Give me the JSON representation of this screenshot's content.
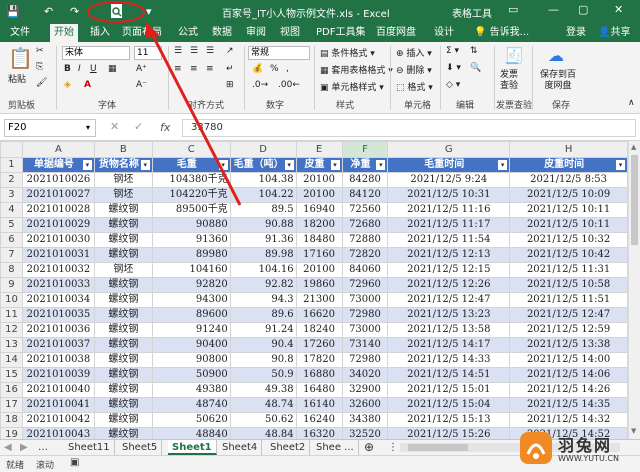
{
  "titlebar": {
    "title": "百家号_IT小人物示例文件.xls - Excel",
    "tools": "表格工具",
    "undo": "↶",
    "redo": "↷"
  },
  "tabs": [
    "文件",
    "开始",
    "插入",
    "页面布局",
    "公式",
    "数据",
    "审阅",
    "视图",
    "PDF工具集",
    "百度网盘",
    "设计"
  ],
  "tabs_extra": {
    "tell": "告诉我...",
    "login": "登录",
    "share": "共享"
  },
  "ribbon": {
    "paste": "粘贴",
    "clipboard": "剪贴板",
    "font_name": "宋体",
    "font_size": "11",
    "font": "字体",
    "align": "对齐方式",
    "num_format": "常规",
    "number": "数字",
    "percent": "%",
    "comma": ",",
    "cond": "条件格式",
    "table_fmt": "套用表格格式",
    "cell_style": "单元格样式",
    "styles": "样式",
    "insert": "插入",
    "delete": "删除",
    "format": "格式",
    "cells": "单元格",
    "edit": "编辑",
    "invoice": "发票查验",
    "invoice_grp": "发票查验",
    "save_baidu": "保存到百度网盘",
    "save_grp": "保存"
  },
  "formula": {
    "namebox": "F20",
    "fx": "fx",
    "value": "33780"
  },
  "columns": [
    "A",
    "B",
    "C",
    "D",
    "E",
    "F",
    "G",
    "H"
  ],
  "headers": [
    "单据编号",
    "货物名称",
    "毛重",
    "毛重（吨）",
    "皮重",
    "净重",
    "毛重时间",
    "皮重时间"
  ],
  "rows": [
    [
      "2021010026",
      "钢坯",
      "104380千克",
      "104.38",
      "20100",
      "84280",
      "2021/12/5 9:24",
      "2021/12/5 8:53"
    ],
    [
      "2021010027",
      "钢坯",
      "104220千克",
      "104.22",
      "20100",
      "84120",
      "2021/12/5 10:31",
      "2021/12/5 10:09"
    ],
    [
      "2021010028",
      "螺纹钢",
      "89500千克",
      "89.5",
      "16940",
      "72560",
      "2021/12/5 11:16",
      "2021/12/5 10:11"
    ],
    [
      "2021010029",
      "螺纹钢",
      "90880",
      "90.88",
      "18200",
      "72680",
      "2021/12/5 11:17",
      "2021/12/5 10:11"
    ],
    [
      "2021010030",
      "螺纹钢",
      "91360",
      "91.36",
      "18480",
      "72880",
      "2021/12/5 11:54",
      "2021/12/5 10:32"
    ],
    [
      "2021010031",
      "螺纹钢",
      "89980",
      "89.98",
      "17160",
      "72820",
      "2021/12/5 12:13",
      "2021/12/5 10:42"
    ],
    [
      "2021010032",
      "钢坯",
      "104160",
      "104.16",
      "20100",
      "84060",
      "2021/12/5 12:15",
      "2021/12/5 11:31"
    ],
    [
      "2021010033",
      "螺纹钢",
      "92820",
      "92.82",
      "19860",
      "72960",
      "2021/12/5 12:26",
      "2021/12/5 10:58"
    ],
    [
      "2021010034",
      "螺纹钢",
      "94300",
      "94.3",
      "21300",
      "73000",
      "2021/12/5 12:47",
      "2021/12/5 11:51"
    ],
    [
      "2021010035",
      "螺纹钢",
      "89600",
      "89.6",
      "16620",
      "72980",
      "2021/12/5 13:23",
      "2021/12/5 12:47"
    ],
    [
      "2021010036",
      "螺纹钢",
      "91240",
      "91.24",
      "18240",
      "73000",
      "2021/12/5 13:58",
      "2021/12/5 12:59"
    ],
    [
      "2021010037",
      "螺纹钢",
      "90400",
      "90.4",
      "17260",
      "73140",
      "2021/12/5 14:17",
      "2021/12/5 13:38"
    ],
    [
      "2021010038",
      "螺纹钢",
      "90800",
      "90.8",
      "17820",
      "72980",
      "2021/12/5 14:33",
      "2021/12/5 14:00"
    ],
    [
      "2021010039",
      "螺纹钢",
      "50900",
      "50.9",
      "16880",
      "34020",
      "2021/12/5 14:51",
      "2021/12/5 14:06"
    ],
    [
      "2021010040",
      "螺纹钢",
      "49380",
      "49.38",
      "16480",
      "32900",
      "2021/12/5 15:01",
      "2021/12/5 14:26"
    ],
    [
      "2021010041",
      "螺纹钢",
      "48740",
      "48.74",
      "16140",
      "32600",
      "2021/12/5 15:04",
      "2021/12/5 14:35"
    ],
    [
      "2021010042",
      "螺纹钢",
      "50620",
      "50.62",
      "16240",
      "34380",
      "2021/12/5 15:13",
      "2021/12/5 14:32"
    ],
    [
      "2021010043",
      "螺纹钢",
      "48840",
      "48.84",
      "16320",
      "32520",
      "2021/12/5 15:26",
      "2021/12/5 14:52"
    ],
    [
      "2021010044",
      "螺纹钢",
      "51780",
      "51.78",
      "18000",
      "33780",
      "2021/12/5 15:38",
      "2021/12/5 15:00"
    ]
  ],
  "row_numbers": [
    "1",
    "2",
    "3",
    "4",
    "5",
    "6",
    "7",
    "8",
    "9",
    "10",
    "11",
    "12",
    "13",
    "14",
    "15",
    "16",
    "17",
    "18",
    "19",
    "20"
  ],
  "sheets": [
    "Sheet11",
    "Sheet5",
    "Sheet1",
    "Sheet4",
    "Sheet2",
    "Shee ..."
  ],
  "status": {
    "ready": "就绪",
    "scroll": "滚动"
  },
  "watermark": {
    "name": "羽兔网",
    "url": "WWW.YUTU.CN"
  }
}
